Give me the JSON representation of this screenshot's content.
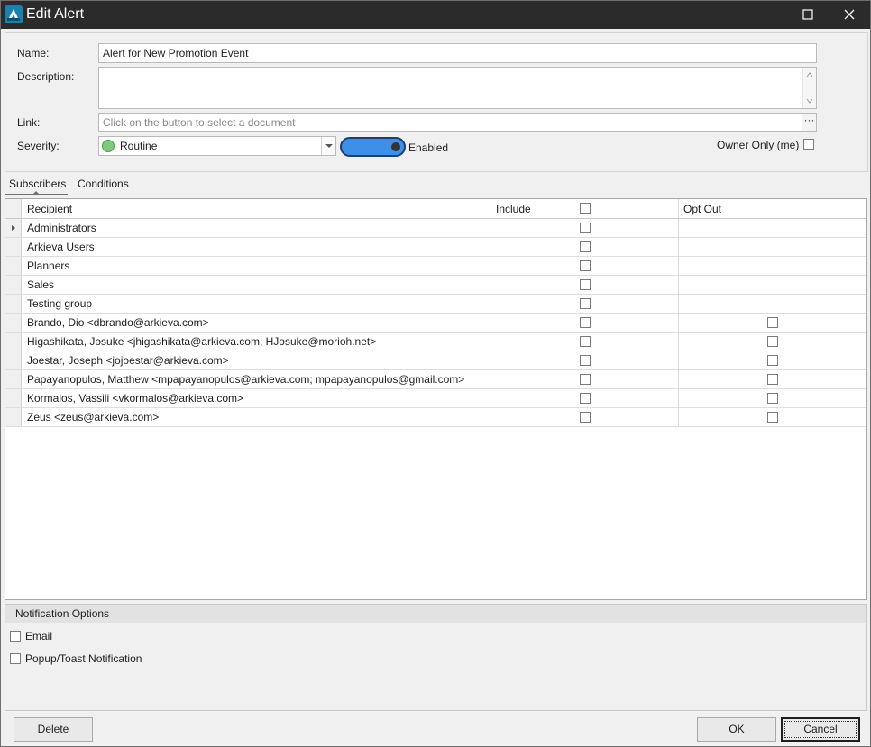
{
  "window": {
    "title": "Edit Alert"
  },
  "form": {
    "name_label": "Name:",
    "name_value": "Alert for New Promotion Event",
    "description_label": "Description:",
    "description_value": "",
    "link_label": "Link:",
    "link_placeholder": "Click on the button to select a document",
    "link_button": "···",
    "severity_label": "Severity:",
    "severity_value": "Routine",
    "enabled_label": "Enabled",
    "enabled": true,
    "owner_only_label": "Owner Only (me)",
    "owner_only": false
  },
  "tabs": [
    {
      "label": "Subscribers",
      "active": true
    },
    {
      "label": "Conditions",
      "active": false
    }
  ],
  "grid": {
    "columns": [
      "Recipient",
      "Include",
      "Opt Out"
    ],
    "rows": [
      {
        "recipient": "Administrators",
        "include": false,
        "opt_out": null,
        "current": true
      },
      {
        "recipient": "Arkieva Users",
        "include": false,
        "opt_out": null
      },
      {
        "recipient": "Planners",
        "include": false,
        "opt_out": null
      },
      {
        "recipient": "Sales",
        "include": false,
        "opt_out": null
      },
      {
        "recipient": "Testing group",
        "include": false,
        "opt_out": null
      },
      {
        "recipient": "Brando, Dio <dbrando@arkieva.com>",
        "include": false,
        "opt_out": false
      },
      {
        "recipient": "Higashikata, Josuke <jhigashikata@arkieva.com; HJosuke@morioh.net>",
        "include": false,
        "opt_out": false
      },
      {
        "recipient": "Joestar, Joseph <jojoestar@arkieva.com>",
        "include": false,
        "opt_out": false
      },
      {
        "recipient": "Papayanopulos, Matthew <mpapayanopulos@arkieva.com; mpapayanopulos@gmail.com>",
        "include": false,
        "opt_out": false
      },
      {
        "recipient": "Kormalos, Vassili <vkormalos@arkieva.com>",
        "include": false,
        "opt_out": false
      },
      {
        "recipient": "Zeus <zeus@arkieva.com>",
        "include": false,
        "opt_out": false
      }
    ]
  },
  "notification_options": {
    "header": "Notification Options",
    "email_label": "Email",
    "email": false,
    "popup_label": "Popup/Toast Notification",
    "popup": false
  },
  "buttons": {
    "delete": "Delete",
    "ok": "OK",
    "cancel": "Cancel"
  },
  "colors": {
    "titlebar": "#2b2b2b",
    "accent": "#3d8fe8",
    "app_icon": "#1b7fb0"
  }
}
